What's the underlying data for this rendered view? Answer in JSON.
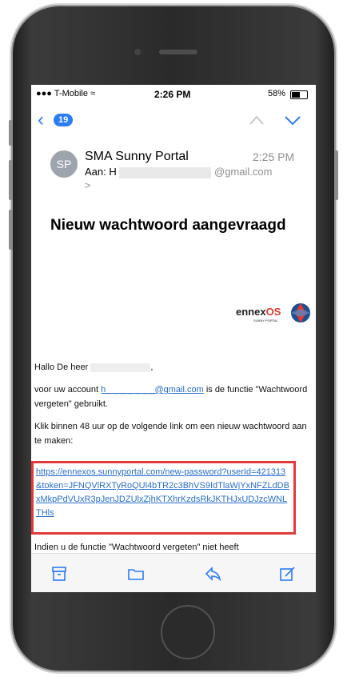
{
  "status_bar": {
    "carrier": "T-Mobile",
    "time": "2:26 PM",
    "battery": "58%"
  },
  "nav": {
    "back_count": "19",
    "icons": [
      "back-chevron-icon",
      "chevron-up-icon",
      "chevron-down-icon"
    ]
  },
  "message": {
    "avatar_initials": "SP",
    "sender": "SMA Sunny Portal",
    "time": "2:25 PM",
    "to_label": "Aan: H",
    "to_domain": "@gmail.com",
    "more": ">",
    "subject": "Nieuw wachtwoord aangevraagd",
    "logo_text": "ennex",
    "logo_os": "OS",
    "logo_sub": "SUNNY PORTAL",
    "greeting_prefix": "Hallo De heer",
    "greeting_suffix": ",",
    "account_prefix": "voor uw account",
    "account_email": "h_ _ _ _ _ _ _@gmail.com",
    "account_suffix": "is de functie \"Wachtwoord vergeten\" gebruikt.",
    "instructions": "Klik binnen 48 uur op de volgende link om een nieuw wachtwoord aan te maken:",
    "reset_link": "https://ennexos.sunnyportal.com/new-password?userId=421313&token=JFNQVlRXTyRoQUl4bTR2c3BhVS9IdTlaWjYxNFZLdDBxMkpPdVUxR3pJenJDZUlxZjhKTXhrKzdsRkJKTHJxUDJzcWNLTHls",
    "truncated_text": "Indien u de functie \"Wachtwoord vergeten\" niet heeft"
  },
  "toolbar": {
    "icons": [
      "archive-icon",
      "folder-icon",
      "reply-icon",
      "compose-icon"
    ]
  },
  "colors": {
    "accent": "#2c7cf6",
    "link": "#2a6fcd",
    "highlight": "#e23a3a",
    "logo_red": "#e2382f"
  }
}
